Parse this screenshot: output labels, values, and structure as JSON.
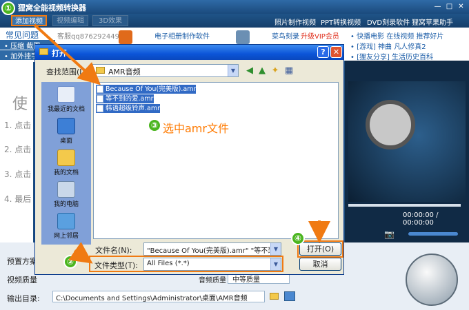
{
  "app": {
    "title": "狸窝全能视频转换器",
    "toolbar": {
      "add_video": "添加视频",
      "edit_video": "视频编辑",
      "effect_3d": "3D效果"
    },
    "top_links": [
      "照片制作视频",
      "PPT转换视频",
      "DVD刻录软件",
      "狸窝苹果助手"
    ],
    "faq": "常见问题",
    "faq_items": [
      "• 压缩  截图",
      "• 加外挂字"
    ],
    "qq": "客服qq876292449",
    "ads": {
      "col1": [
        "电子相册制作软件",
        "优秀视频转换"
      ],
      "col2": [
        "菜鸟刻录 ",
        "升级VIP会员",
        "刻录DVD 光盘刻录"
      ],
      "col3": [
        "• 快播电影  在线视频  推荐好片",
        "• [游戏] 神曲  凡人修真2",
        "• [狸友分享] 生活历史百科"
      ]
    },
    "steps": [
      "使",
      "1. 点击",
      "2. 点击",
      "3. 点击",
      "4. 最后"
    ],
    "time": "00:00:00 / 00:00:00",
    "bottom": {
      "preset_label": "预置方案",
      "quality_label": "视频质量",
      "audio_label": "音频质量",
      "audio_value": "中等质量",
      "output_label": "输出目录:",
      "output_value": "C:\\Documents and Settings\\Administrator\\桌面\\AMR音频"
    }
  },
  "dialog": {
    "title": "打开",
    "look_in_label": "查找范围(I):",
    "look_in_value": "AMR音频",
    "places": [
      "我最近的文档",
      "桌面",
      "我的文档",
      "我的电脑",
      "网上邻居"
    ],
    "files": [
      "Because Of You(完美版).amr",
      "等不到的爱.amr",
      "韩语超级铃声.amr"
    ],
    "annotation": "选中amr文件",
    "filename_label": "文件名(N):",
    "filename_value": "\"Because Of You(完美版).amr\" \"等不到的",
    "filetype_label": "文件类型(T):",
    "filetype_value": "All Files (*.*)",
    "open_button": "打开(O)",
    "cancel_button": "取消"
  },
  "steps_markers": [
    "①",
    "②",
    "③",
    "④"
  ],
  "colors": {
    "highlight": "#f07a12",
    "selection": "#316ac5",
    "marker": "#4bb51f"
  }
}
